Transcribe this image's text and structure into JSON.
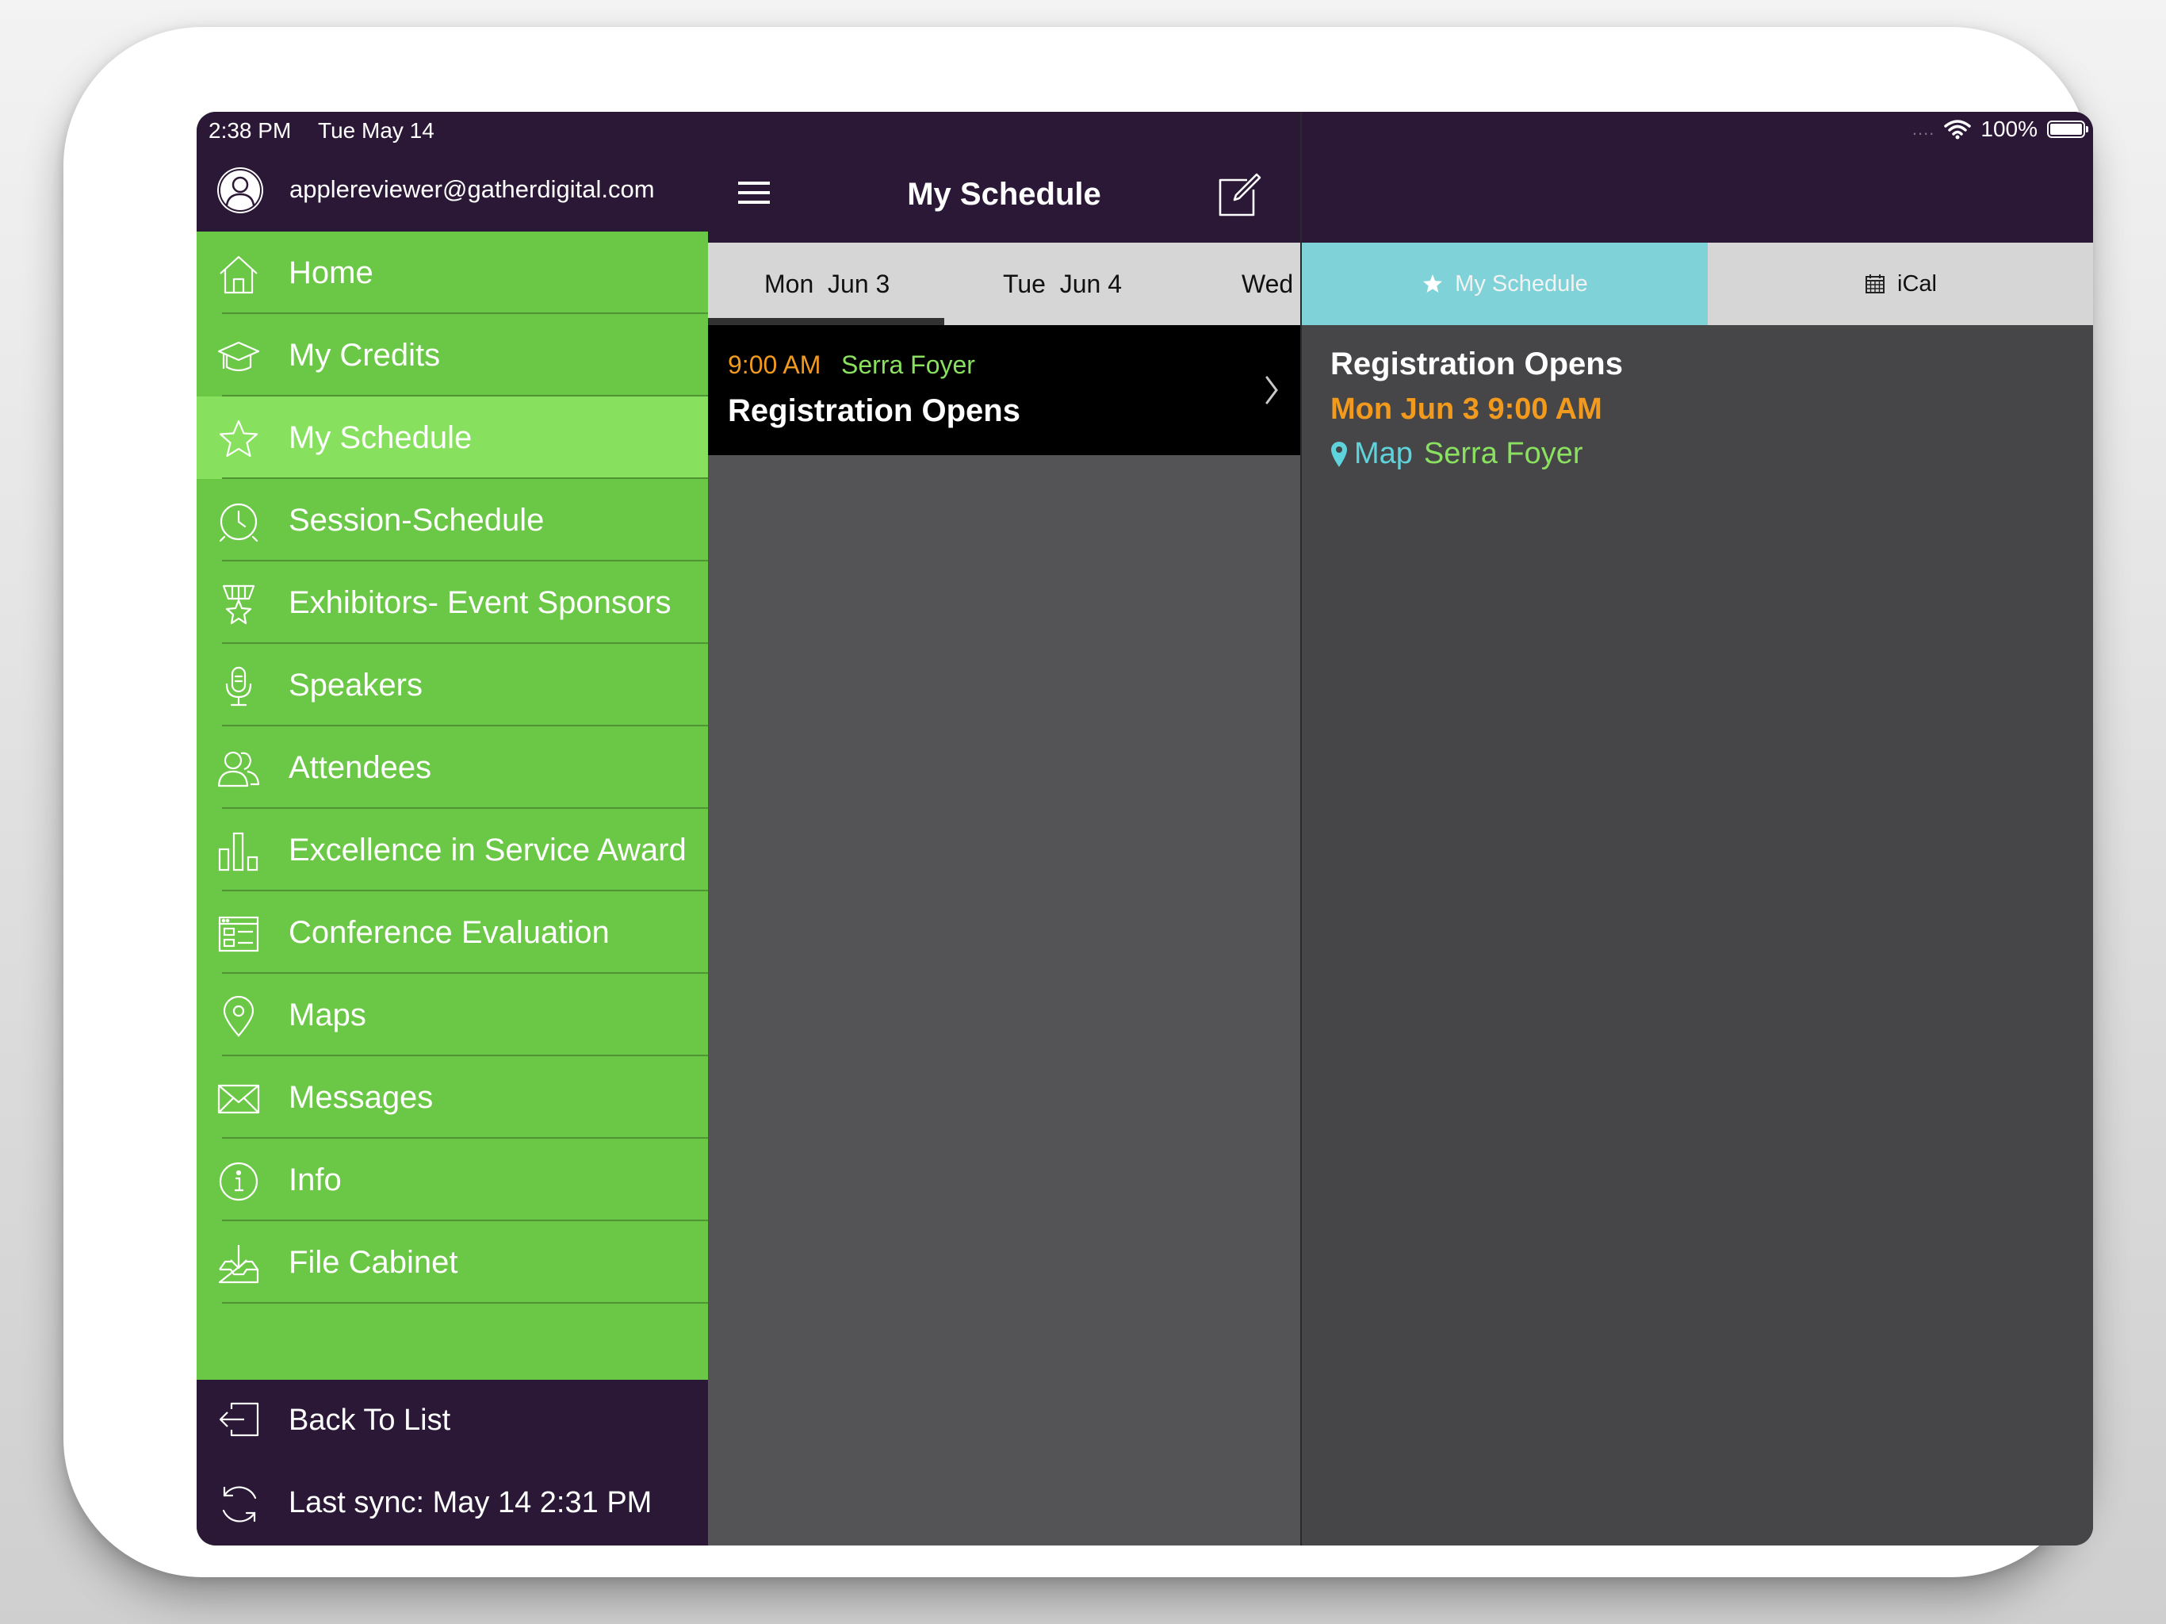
{
  "status_bar": {
    "time": "2:38 PM",
    "date": "Tue May 14",
    "dots": "....",
    "battery": "100%"
  },
  "user": {
    "email": "applereviewer@gatherdigital.com"
  },
  "menu": {
    "items": [
      {
        "label": "Home",
        "icon": "home-icon"
      },
      {
        "label": "My Credits",
        "icon": "graduation-cap-icon"
      },
      {
        "label": "My Schedule",
        "icon": "star-icon",
        "active": true
      },
      {
        "label": "Session-Schedule",
        "icon": "clock-icon"
      },
      {
        "label": "Exhibitors- Event Sponsors",
        "icon": "award-icon"
      },
      {
        "label": "Speakers",
        "icon": "microphone-icon"
      },
      {
        "label": "Attendees",
        "icon": "people-icon"
      },
      {
        "label": "Excellence in Service Award",
        "icon": "bar-chart-icon"
      },
      {
        "label": "Conference Evaluation",
        "icon": "form-icon"
      },
      {
        "label": "Maps",
        "icon": "map-pin-icon"
      },
      {
        "label": "Messages",
        "icon": "envelope-icon"
      },
      {
        "label": "Info",
        "icon": "info-icon"
      },
      {
        "label": "File Cabinet",
        "icon": "download-tray-icon"
      }
    ]
  },
  "footer": {
    "back_label": "Back To List",
    "sync_label": "Last sync:  May 14 2:31 PM"
  },
  "schedule": {
    "title": "My Schedule",
    "day_tabs": [
      "Mon  Jun 3",
      "Tue  Jun 4",
      "Wed"
    ],
    "selected_day": "Mon  Jun 3",
    "events": [
      {
        "time": "9:00 AM",
        "location": "Serra Foyer",
        "title": "Registration Opens"
      }
    ]
  },
  "detail": {
    "segments": {
      "my_schedule": "My Schedule",
      "ical": "iCal"
    },
    "title": "Registration Opens",
    "datetime": "Mon Jun 3 9:00 AM",
    "map_label": "Map",
    "location": "Serra Foyer"
  },
  "colors": {
    "header_purple": "#2b1736",
    "sidebar_green": "#6bc846",
    "active_green": "#87e15e",
    "time_orange": "#f29a1e",
    "location_green": "#8ae05f",
    "segment_teal": "#7fd3d8"
  }
}
